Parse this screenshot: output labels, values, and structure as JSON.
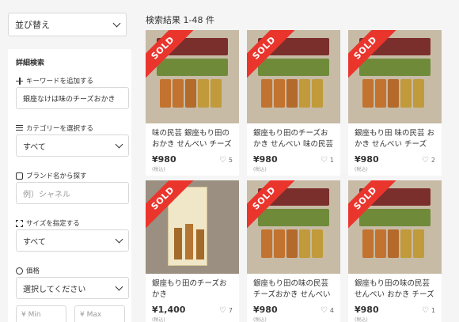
{
  "sidebar": {
    "sort": {
      "label": "並び替え"
    },
    "panel_title": "詳細検索",
    "keyword": {
      "label": "キーワードを追加する",
      "value": "銀座なけは味のチーズおかき"
    },
    "category": {
      "label": "カテゴリーを選択する",
      "value": "すべて"
    },
    "brand": {
      "label": "ブランド名から探す",
      "placeholder": "例）シャネル"
    },
    "size": {
      "label": "サイズを指定する",
      "value": "すべて"
    },
    "price": {
      "label": "価格",
      "value": "選択してください",
      "min_placeholder": "¥ Min",
      "max_placeholder": "¥ Max"
    }
  },
  "results": {
    "title": "検索結果 1-48 件",
    "items": [
      {
        "title": "味の民芸 銀座もり田のおかき せんべい チーズ",
        "price": "¥980",
        "tax": "(税込)",
        "likes": "5",
        "sold": "SOLD"
      },
      {
        "title": "銀座もり田のチーズおかき せんべい 味の民芸",
        "price": "¥980",
        "tax": "(税込)",
        "likes": "1",
        "sold": "SOLD"
      },
      {
        "title": "銀座もり田 味の民芸 おかき せんべい チーズ",
        "price": "¥980",
        "tax": "(税込)",
        "likes": "2",
        "sold": "SOLD"
      },
      {
        "title": "銀座もり田のチーズおかき",
        "price": "¥1,400",
        "tax": "(税込)",
        "likes": "7",
        "sold": "SOLD"
      },
      {
        "title": "銀座もり田の味の民芸 チーズおかき せんべい",
        "price": "¥980",
        "tax": "(税込)",
        "likes": "4",
        "sold": "SOLD"
      },
      {
        "title": "銀座もり田の味の民芸 せんべい おかき チーズ",
        "price": "¥980",
        "tax": "(税込)",
        "likes": "1",
        "sold": "SOLD"
      }
    ]
  },
  "colors": {
    "sold_ribbon": "#ea352d",
    "background": "#f5f5f5"
  }
}
